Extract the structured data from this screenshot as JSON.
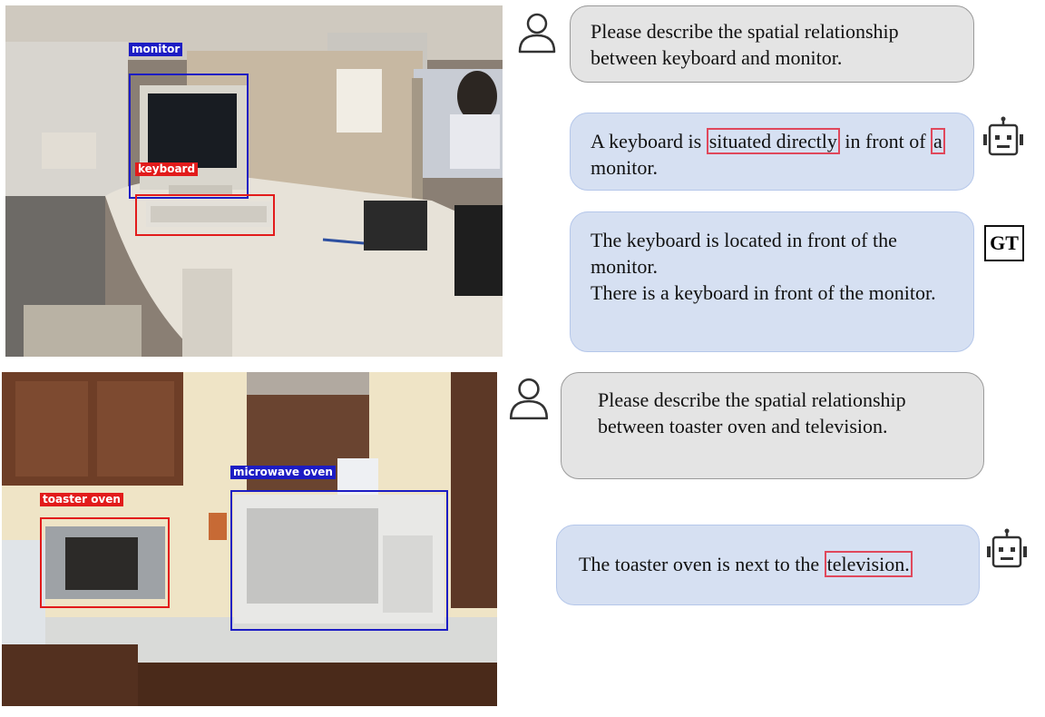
{
  "example1": {
    "labels": {
      "monitor": "monitor",
      "keyboard": "keyboard"
    },
    "question": "Please describe the spatial relationship between  keyboard and monitor.",
    "answer": {
      "p1": "A keyboard is ",
      "hl1": "situated directly",
      "p2": " in front of ",
      "hl2": "a",
      "p3": " monitor."
    },
    "gt_badge": "GT",
    "gt_lines": [
      "The keyboard is located in front of the monitor.",
      "There is a keyboard in front of the monitor."
    ]
  },
  "example2": {
    "labels": {
      "toaster": "toaster oven",
      "microwave": "microwave oven"
    },
    "question": "Please describe the spatial relationship between toaster oven and television.",
    "answer": {
      "p1": "The toaster oven is next to the ",
      "hl1": "television."
    }
  },
  "colors": {
    "box_red": "#e21b1b",
    "box_blue": "#1c1cc4",
    "highlight": "#e0485c",
    "user_bubble": "#e4e4e4",
    "bot_bubble": "#d6e0f2"
  },
  "icons": [
    "user-icon",
    "robot-icon",
    "gt-badge"
  ]
}
